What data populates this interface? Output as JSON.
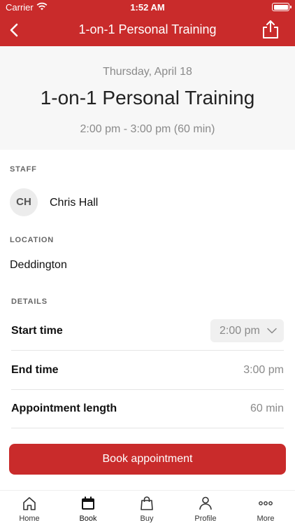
{
  "status_bar": {
    "carrier": "Carrier",
    "time": "1:52 AM"
  },
  "nav": {
    "title": "1-on-1 Personal Training",
    "back_icon": "chevron-left-icon",
    "share_icon": "share-icon"
  },
  "header": {
    "date": "Thursday, April 18",
    "title": "1-on-1 Personal Training",
    "time_range": "2:00 pm - 3:00 pm (60 min)"
  },
  "staff": {
    "section_label": "STAFF",
    "initials": "CH",
    "name": "Chris Hall"
  },
  "location": {
    "section_label": "LOCATION",
    "name": "Deddington"
  },
  "details": {
    "section_label": "DETAILS",
    "start_time_label": "Start time",
    "start_time_value": "2:00 pm",
    "end_time_label": "End time",
    "end_time_value": "3:00 pm",
    "length_label": "Appointment length",
    "length_value": "60 min"
  },
  "actions": {
    "book_label": "Book appointment"
  },
  "colors": {
    "brand": "#c92b2b",
    "header_bg": "#f7f7f7",
    "muted_text": "#8a8a8a"
  },
  "tabbar": {
    "items": [
      {
        "label": "Home",
        "icon": "home-icon"
      },
      {
        "label": "Book",
        "icon": "calendar-icon",
        "active": true
      },
      {
        "label": "Buy",
        "icon": "shopping-bag-icon"
      },
      {
        "label": "Profile",
        "icon": "person-icon"
      },
      {
        "label": "More",
        "icon": "more-dots-icon"
      }
    ]
  }
}
